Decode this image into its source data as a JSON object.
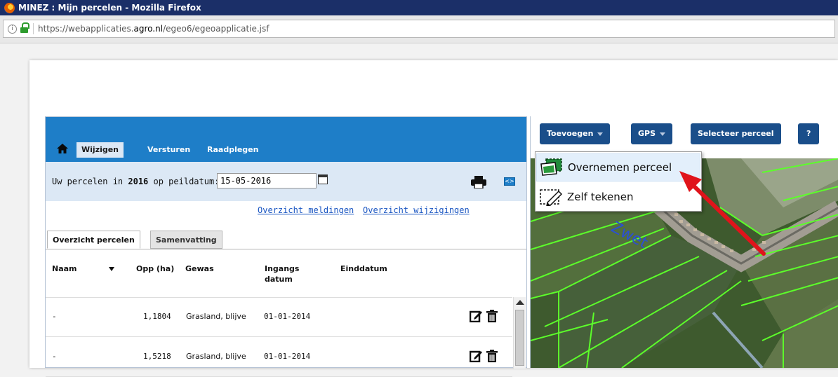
{
  "window": {
    "title": "MINEZ : Mijn percelen - Mozilla Firefox"
  },
  "address": {
    "url_prefix": "https://webapplicaties.",
    "url_host": "agro.nl",
    "url_path": "/egeo6/egeoapplicatie.jsf"
  },
  "nav": {
    "tabs": [
      "Wijzigen",
      "Versturen",
      "Raadplegen"
    ],
    "active_tab": "Wijzigen"
  },
  "filter": {
    "prefix": "Uw percelen in ",
    "year": "2016",
    "suffix": " op peildatum:",
    "date_value": "15-05-2016"
  },
  "links": {
    "meldingen": "Overzicht meldingen",
    "wijzigingen": "Overzicht wijzigingen"
  },
  "subtabs": [
    "Overzicht percelen",
    "Samenvatting"
  ],
  "table": {
    "headers": {
      "naam": "Naam",
      "opp": "Opp (ha)",
      "gewas": "Gewas",
      "ingangs": "Ingangs datum",
      "eind": "Einddatum"
    },
    "rows": [
      {
        "naam": "-",
        "opp": "1,1804",
        "gewas": "Grasland, blijve",
        "ingangs": "01-01-2014"
      },
      {
        "naam": "-",
        "opp": "1,5218",
        "gewas": "Grasland, blijve",
        "ingangs": "01-01-2014"
      }
    ]
  },
  "map_toolbar": {
    "toevoegen": "Toevoegen",
    "gps": "GPS",
    "selecteer": "Selecteer perceel",
    "help": "?"
  },
  "dropdown": {
    "item1": "Overnemen perceel",
    "item2": "Zelf tekenen"
  },
  "map": {
    "label": "Zwet"
  },
  "colors": {
    "nav_blue": "#1e7ec8",
    "button_blue": "#1a4e8a",
    "parcel_green": "#5cff2a",
    "arrow_red": "#e0141b"
  }
}
